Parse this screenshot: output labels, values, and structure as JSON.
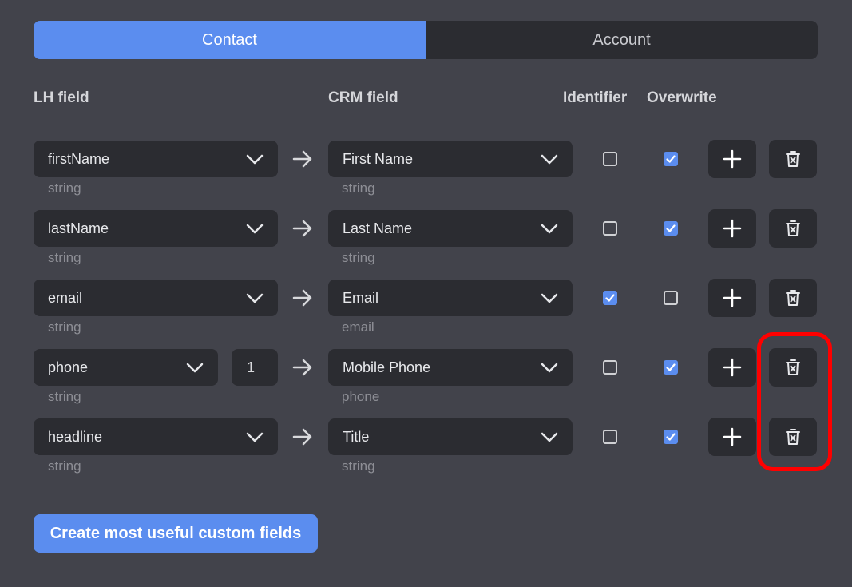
{
  "tabs": [
    {
      "label": "Contact",
      "active": true
    },
    {
      "label": "Account",
      "active": false
    }
  ],
  "headers": {
    "lh_field": "LH field",
    "crm_field": "CRM field",
    "identifier": "Identifier",
    "overwrite": "Overwrite"
  },
  "rows": [
    {
      "lh_value": "firstName",
      "lh_type": "string",
      "crm_value": "First Name",
      "crm_type": "string",
      "identifier": false,
      "overwrite": true
    },
    {
      "lh_value": "lastName",
      "lh_type": "string",
      "crm_value": "Last Name",
      "crm_type": "string",
      "identifier": false,
      "overwrite": true
    },
    {
      "lh_value": "email",
      "lh_type": "string",
      "crm_value": "Email",
      "crm_type": "email",
      "identifier": true,
      "overwrite": false
    },
    {
      "lh_value": "phone",
      "lh_type": "string",
      "index": "1",
      "crm_value": "Mobile Phone",
      "crm_type": "phone",
      "identifier": false,
      "overwrite": true
    },
    {
      "lh_value": "headline",
      "lh_type": "string",
      "crm_value": "Title",
      "crm_type": "string",
      "identifier": false,
      "overwrite": true
    }
  ],
  "icons": {
    "chevron": "chevron-down-icon",
    "arrow": "arrow-right-icon",
    "add": "plus-icon",
    "delete": "trash-icon"
  },
  "colors": {
    "accent": "#5b8def",
    "highlight": "#ff0000"
  },
  "cta_label": "Create most useful custom fields"
}
